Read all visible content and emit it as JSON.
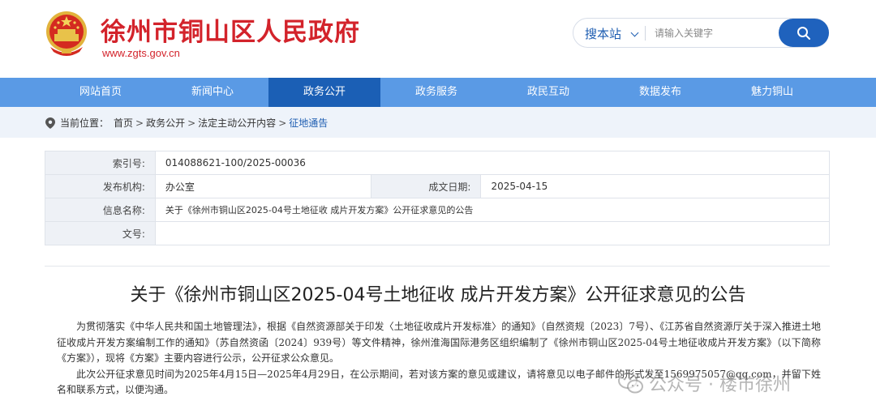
{
  "header": {
    "site_title": "徐州市铜山区人民政府",
    "site_url": "www.zgts.gov.cn",
    "emblem_icon": "national-emblem-icon"
  },
  "search": {
    "scope_label": "搜本站",
    "placeholder": "请输入关键字",
    "button_icon": "search-icon"
  },
  "nav": {
    "items": [
      {
        "label": "网站首页"
      },
      {
        "label": "新闻中心"
      },
      {
        "label": "政务公开",
        "active": true
      },
      {
        "label": "政务服务"
      },
      {
        "label": "政民互动"
      },
      {
        "label": "数据发布"
      },
      {
        "label": "魅力铜山"
      }
    ]
  },
  "breadcrumb": {
    "prefix": "当前位置：",
    "items": [
      "首页",
      "政务公开",
      "法定主动公开内容",
      "征地通告"
    ]
  },
  "meta": {
    "index_label": "索引号:",
    "index_value": "014088621-100/2025-00036",
    "org_label": "发布机构:",
    "org_value": "办公室",
    "date_label": "成文日期:",
    "date_value": "2025-04-15",
    "name_label": "信息名称:",
    "name_value": "关于《徐州市铜山区2025-04号土地征收 成片开发方案》公开征求意见的公告",
    "docno_label": "文号:",
    "docno_value": ""
  },
  "document": {
    "title": "关于《徐州市铜山区2025-04号土地征收 成片开发方案》公开征求意见的公告",
    "paragraphs": [
      "为贯彻落实《中华人民共和国土地管理法》，根据《自然资源部关于印发〈土地征收成片开发标准〉的通知》（自然资规〔2023〕7号）、《江苏省自然资源厅关于深入推进土地征收成片开发方案编制工作的通知》（苏自然资函〔2024〕939号）等文件精神，徐州淮海国际港务区组织编制了《徐州市铜山区2025-04号土地征收成片开发方案》（以下简称《方案》），现将《方案》主要内容进行公示，公开征求公众意见。",
      "此次公开征求意见时间为2025年4月15日—2025年4月29日，在公示期间，若对该方案的意见或建议，请将意见以电子邮件的形式发至1569975057@qq.com，并留下姓名和联系方式，以便沟通。"
    ]
  },
  "watermark": {
    "text": "公众号 · 楼市徐州"
  },
  "colors": {
    "brand_red": "#d3232b",
    "nav_blue": "#5a9ae5",
    "nav_active": "#1b5fb5",
    "link_blue": "#1d5db1"
  }
}
